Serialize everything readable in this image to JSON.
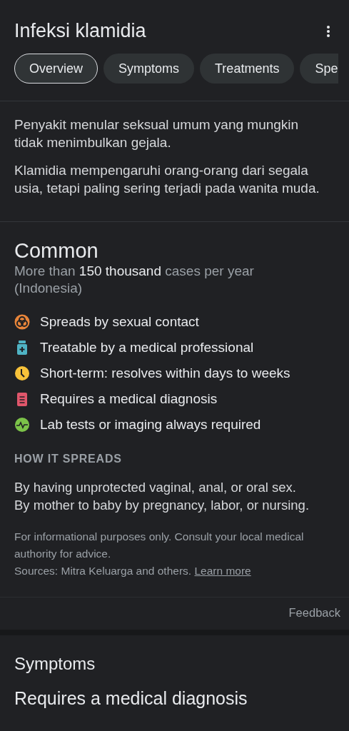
{
  "title": "Infeksi klamidia",
  "tabs": [
    {
      "label": "Overview",
      "selected": true
    },
    {
      "label": "Symptoms",
      "selected": false
    },
    {
      "label": "Treatments",
      "selected": false
    },
    {
      "label": "Spe",
      "selected": false
    }
  ],
  "description": [
    "Penyakit menular seksual umum yang mungkin tidak menimbulkan gejala.",
    "Klamidia mempengaruhi orang-orang dari segala usia, tetapi paling sering terjadi pada wanita muda."
  ],
  "prevalence": {
    "heading": "Common",
    "detail": "More than **150 thousand** cases per year (Indonesia)"
  },
  "facts": [
    {
      "kind": "contact",
      "color": "#e8853a",
      "text": "Spreads by sexual contact"
    },
    {
      "kind": "medicine",
      "color": "#4fb3c4",
      "text": "Treatable by a medical professional"
    },
    {
      "kind": "clock",
      "color": "#f7c23a",
      "text": "Short-term: resolves within days to weeks"
    },
    {
      "kind": "clipboard",
      "color": "#e0566b",
      "text": "Requires a medical diagnosis"
    },
    {
      "kind": "pulse",
      "color": "#7cc349",
      "text": "Lab tests or imaging always required"
    }
  ],
  "how_it_spreads": {
    "heading": "HOW IT SPREADS",
    "lines": [
      "By having unprotected vaginal, anal, or oral sex.",
      "By mother to baby by pregnancy, labor, or nursing."
    ]
  },
  "disclaimer": "For informational purposes only. Consult your local medical authority for advice.",
  "sources": {
    "text": "Sources: Mitra Keluarga and others.",
    "link": "Learn more"
  },
  "feedback": "Feedback",
  "symptoms": {
    "heading": "Symptoms",
    "subheading": "Requires a medical diagnosis"
  }
}
